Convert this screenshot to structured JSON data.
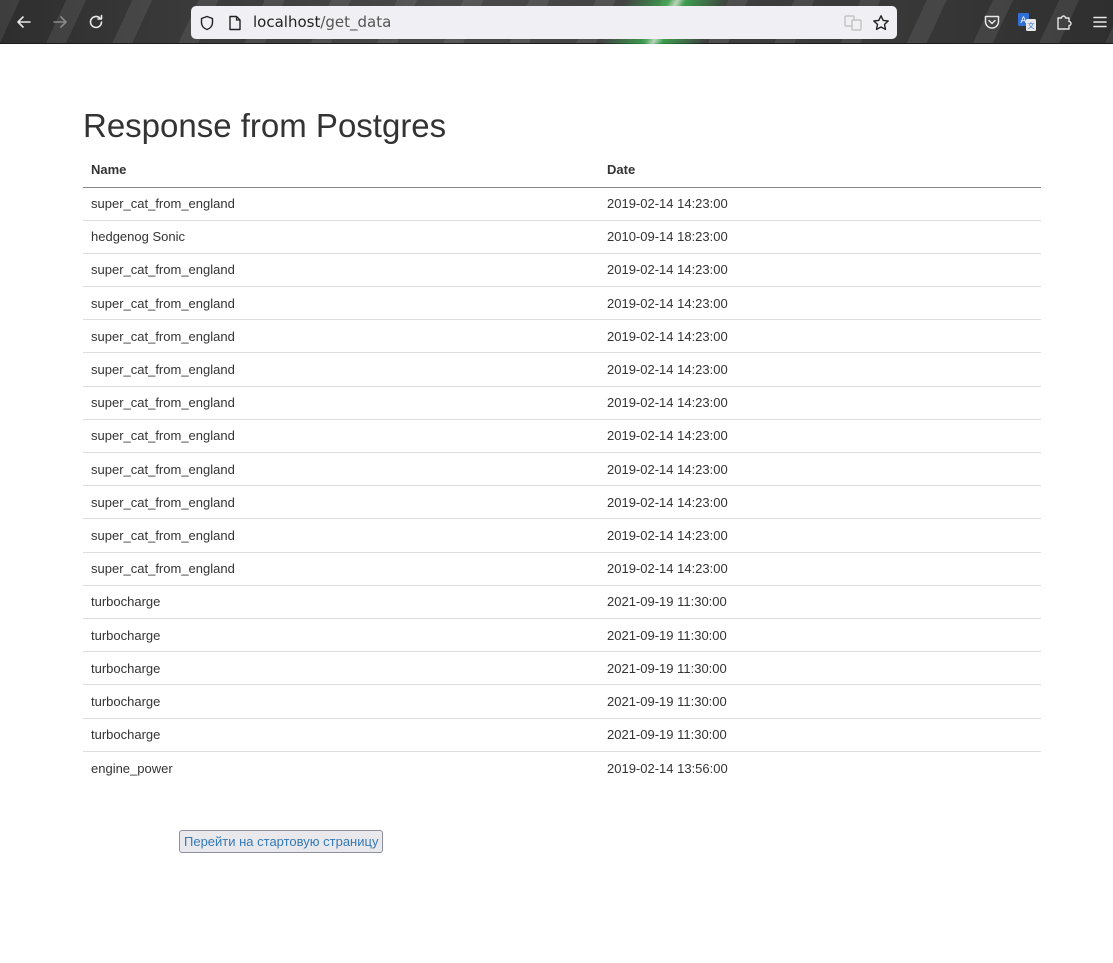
{
  "browser": {
    "url_host": "localhost",
    "url_path": "/get_data"
  },
  "page": {
    "title": "Response from Postgres",
    "columns": [
      "Name",
      "Date"
    ],
    "rows": [
      [
        "super_cat_from_england",
        "2019-02-14 14:23:00"
      ],
      [
        "hedgenog Sonic",
        "2010-09-14 18:23:00"
      ],
      [
        "super_cat_from_england",
        "2019-02-14 14:23:00"
      ],
      [
        "super_cat_from_england",
        "2019-02-14 14:23:00"
      ],
      [
        "super_cat_from_england",
        "2019-02-14 14:23:00"
      ],
      [
        "super_cat_from_england",
        "2019-02-14 14:23:00"
      ],
      [
        "super_cat_from_england",
        "2019-02-14 14:23:00"
      ],
      [
        "super_cat_from_england",
        "2019-02-14 14:23:00"
      ],
      [
        "super_cat_from_england",
        "2019-02-14 14:23:00"
      ],
      [
        "super_cat_from_england",
        "2019-02-14 14:23:00"
      ],
      [
        "super_cat_from_england",
        "2019-02-14 14:23:00"
      ],
      [
        "super_cat_from_england",
        "2019-02-14 14:23:00"
      ],
      [
        "turbocharge",
        "2021-09-19 11:30:00"
      ],
      [
        "turbocharge",
        "2021-09-19 11:30:00"
      ],
      [
        "turbocharge",
        "2021-09-19 11:30:00"
      ],
      [
        "turbocharge",
        "2021-09-19 11:30:00"
      ],
      [
        "turbocharge",
        "2021-09-19 11:30:00"
      ],
      [
        "engine_power",
        "2019-02-14 13:56:00"
      ]
    ],
    "start_button_label": "Перейти на стартовую страницу"
  },
  "icons": {
    "back": "back-arrow-icon",
    "forward": "forward-arrow-icon",
    "reload": "reload-icon",
    "tracking": "shield-icon",
    "page": "page-icon",
    "translate": "translate-icon",
    "bookmark": "star-icon",
    "pocket": "pocket-icon",
    "account": "translate-extension-icon",
    "extensions": "puzzle-icon",
    "menu": "hamburger-menu-icon"
  },
  "colors": {
    "link_blue": "#337ab7",
    "text": "#333333"
  }
}
